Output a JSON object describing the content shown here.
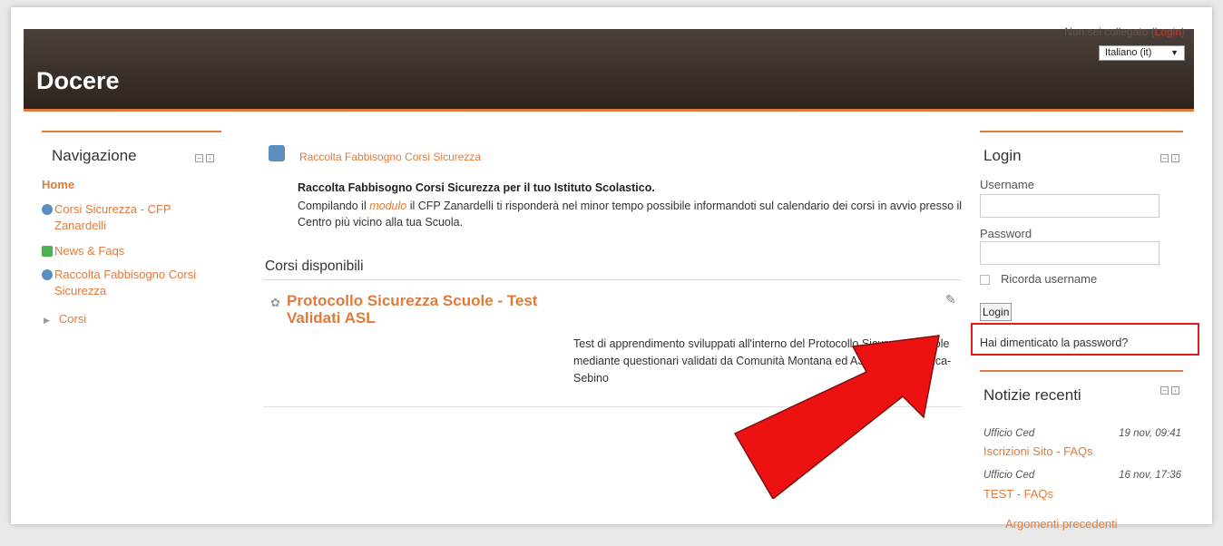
{
  "header": {
    "site_title": "Docere",
    "login_info_text": "Non sei collegato",
    "login_info_link": "Login",
    "language": "Italiano (it)"
  },
  "navigation": {
    "title": "Navigazione",
    "home": "Home",
    "items": [
      {
        "label": "Corsi Sicurezza - CFP Zanardelli",
        "icon": "globe-icon"
      },
      {
        "label": "News & Faqs",
        "icon": "forum-icon"
      },
      {
        "label": "Raccolta Fabbisogno Corsi Sicurezza",
        "icon": "globe-icon"
      }
    ],
    "tree_item": "Corsi"
  },
  "main": {
    "module_link": "Raccolta Fabbisogno Corsi Sicurezza",
    "desc_bold": "Raccolta Fabbisogno Corsi Sicurezza per il tuo Istituto Scolastico",
    "desc_prefix": "Compilando il ",
    "desc_module_word": "modulo",
    "desc_suffix": " il CFP Zanardelli ti risponderà nel minor tempo possibile informandoti sul calendario dei corsi in avvio presso il Centro più vicino alla tua Scuola.",
    "section_heading": "Corsi disponibili",
    "course_title": "Protocollo Sicurezza Scuole - Test Validati ASL",
    "course_summary": "Test di apprendimento sviluppati all'interno del Protocollo Sicurezza Scuole mediante questionari validati da Comunità Montana ed ASL Vallecamonica-Sebino"
  },
  "login": {
    "title": "Login",
    "username_label": "Username",
    "password_label": "Password",
    "remember_label": "Ricorda username",
    "login_button": "Login",
    "forgot_link": "Hai dimenticato la password?"
  },
  "news": {
    "title": "Notizie recenti",
    "posts": [
      {
        "author": "Ufficio Ced",
        "date": "19 nov, 09:41",
        "title": "Iscrizioni Sito - FAQs"
      },
      {
        "author": "Ufficio Ced",
        "date": "16 nov, 17:36",
        "title": "TEST - FAQs"
      }
    ],
    "older": "Argomenti precedenti"
  },
  "colors": {
    "accent": "#e07a3a",
    "header_dark": "#2c241d",
    "highlight_red": "#e01a1a"
  }
}
